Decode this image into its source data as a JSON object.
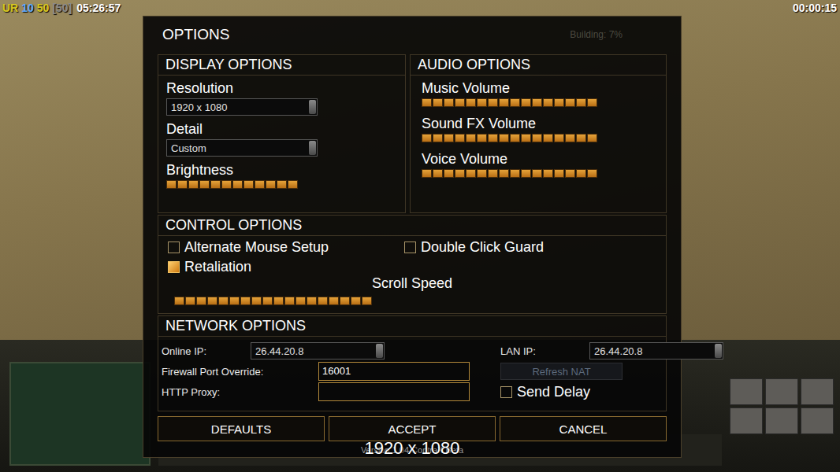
{
  "hud": {
    "counter": [
      {
        "text": "UR",
        "color": "#d8c820"
      },
      {
        "text": "10",
        "color": "#5aa8ff"
      },
      {
        "text": "50",
        "color": "#d8c820"
      },
      {
        "text": "[50]",
        "color": "#8a8a8a"
      }
    ],
    "clock": "05:26:57",
    "game_timer": "00:00:15",
    "build_status": "Building: 7%"
  },
  "dialog": {
    "title": "OPTIONS",
    "display": {
      "title": "DISPLAY OPTIONS",
      "dropdowns": [
        {
          "label": "Resolution",
          "value": "1920 x 1080"
        },
        {
          "label": "Detail",
          "value": "Custom"
        }
      ],
      "brightness": {
        "label": "Brightness",
        "level": 1
      }
    },
    "audio": {
      "title": "AUDIO OPTIONS",
      "sliders": [
        {
          "label": "Music Volume",
          "level": 1
        },
        {
          "label": "Sound FX Volume",
          "level": 1
        },
        {
          "label": "Voice Volume",
          "level": 1
        }
      ]
    },
    "control": {
      "title": "CONTROL OPTIONS",
      "checkboxes": [
        {
          "label": "Alternate Mouse Setup",
          "checked": false
        },
        {
          "label": "Double Click Guard",
          "checked": false
        },
        {
          "label": "Retaliation",
          "checked": true
        }
      ],
      "scroll_speed": {
        "label": "Scroll Speed",
        "level": 1
      }
    },
    "network": {
      "title": "NETWORK OPTIONS",
      "online_ip": {
        "label": "Online IP:",
        "value": "26.44.20.8"
      },
      "lan_ip": {
        "label": "LAN IP:",
        "value": "26.44.20.8"
      },
      "firewall_port": {
        "label": "Firewall Port Override:",
        "value": "16001"
      },
      "http_proxy": {
        "label": "HTTP Proxy:",
        "value": ""
      },
      "refresh_nat": {
        "label": "Refresh NAT",
        "disabled": true
      },
      "send_delay": {
        "label": "Send Delay",
        "checked": false
      }
    },
    "buttons": [
      "DEFAULTS",
      "ACCEPT",
      "CANCEL"
    ],
    "version": "Version 1.04 ContraX Beta",
    "tooltip": "1920 x 1080"
  }
}
